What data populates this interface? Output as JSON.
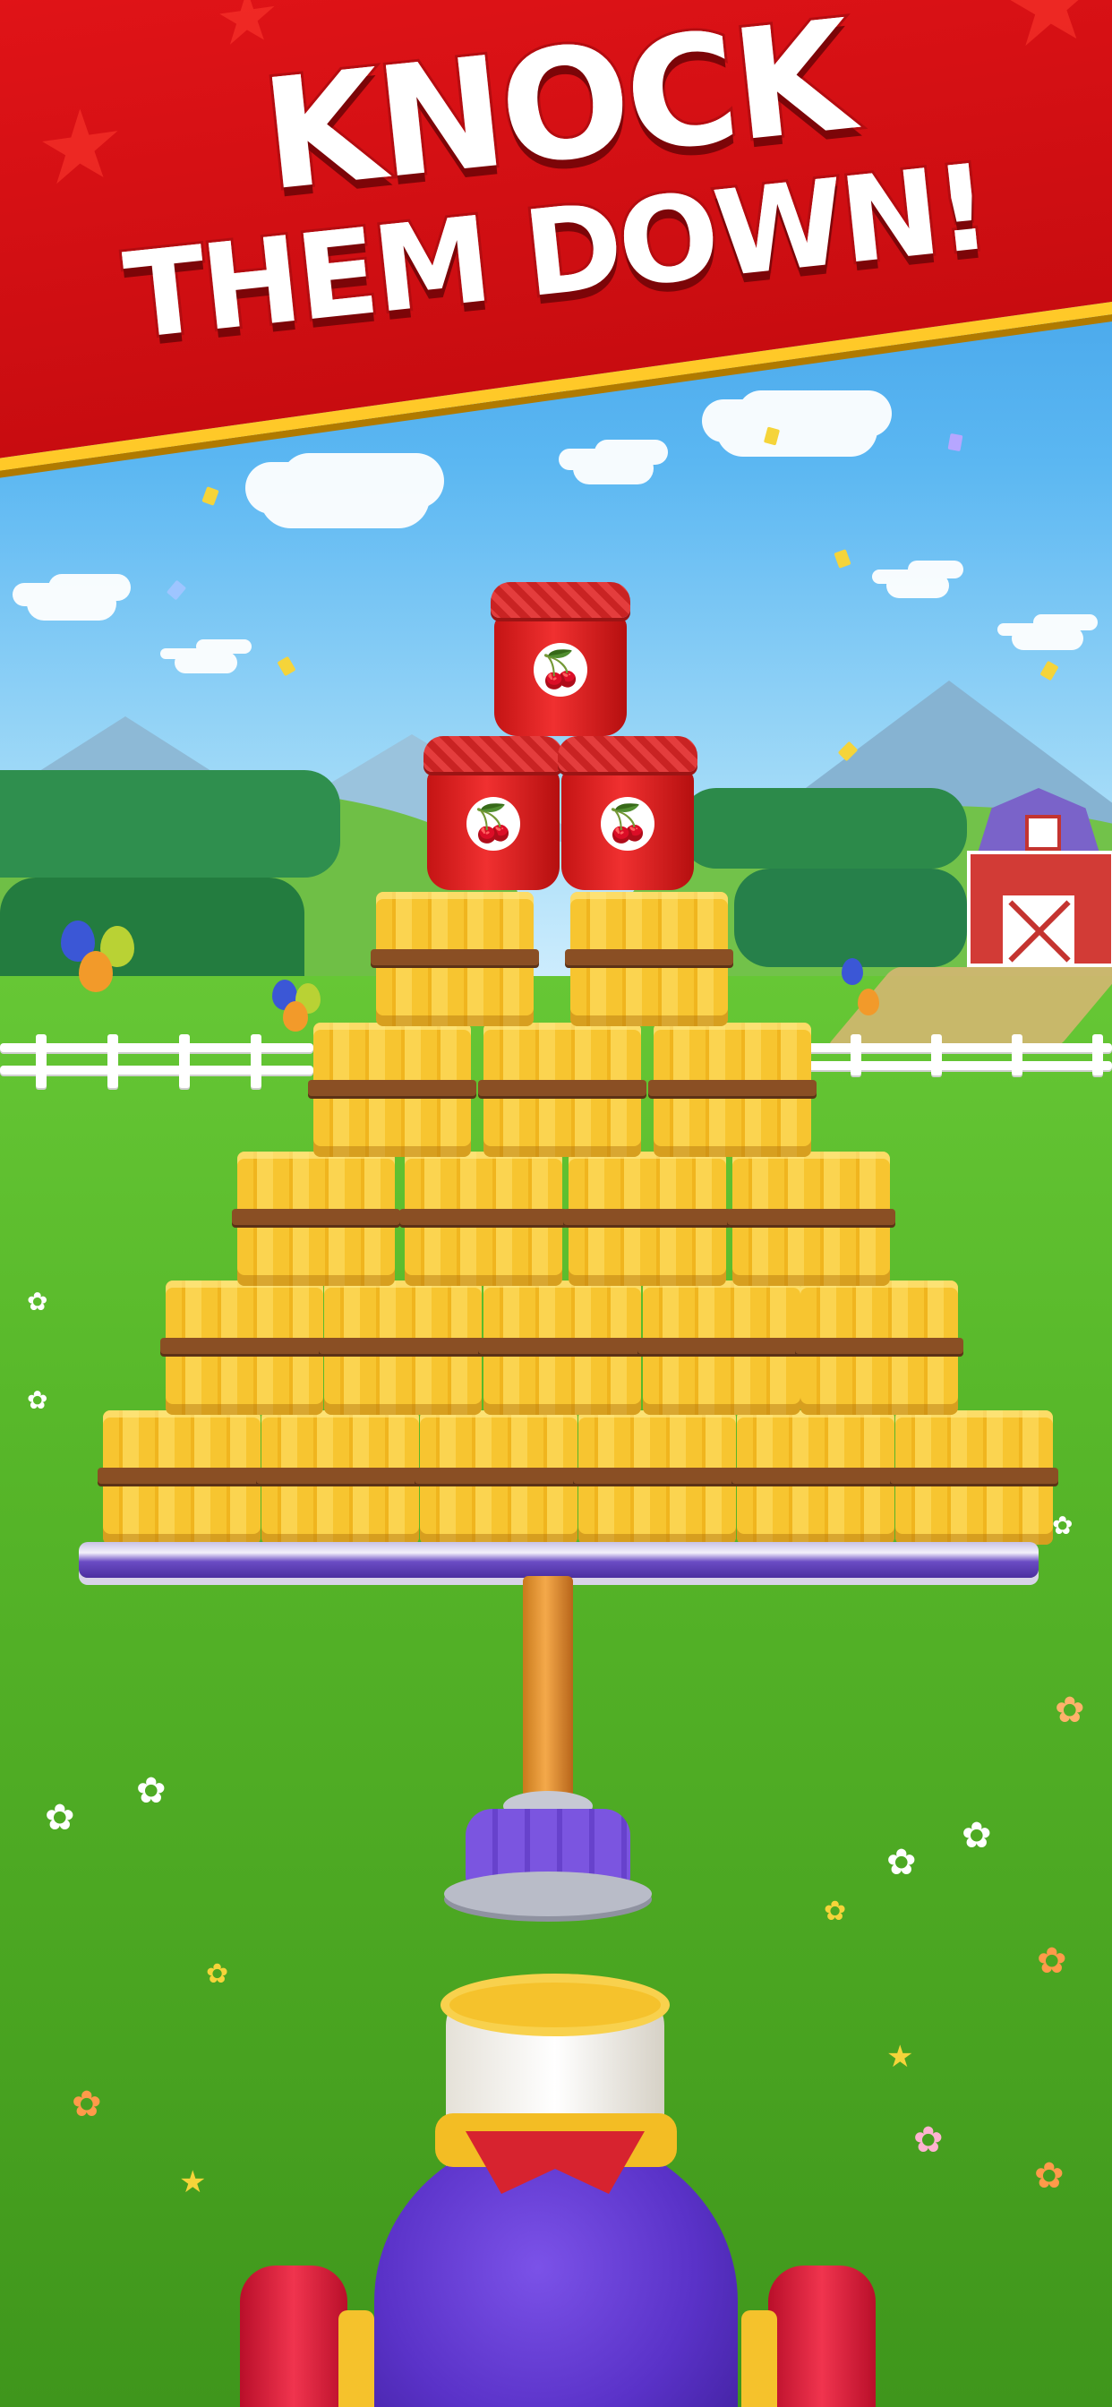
{
  "banner": {
    "line1": "KNOCK",
    "line2": "THEM DOWN!"
  },
  "jar_icon": "🍒",
  "colors": {
    "banner_red": "#e21418",
    "banner_trim": "#ffc928",
    "hay": "#f7c530",
    "jar": "#e02020",
    "cannon": "#5a32c8",
    "grass": "#58b82a"
  },
  "icons": [
    "cherry-icon",
    "star-icon",
    "flower-icon"
  ]
}
